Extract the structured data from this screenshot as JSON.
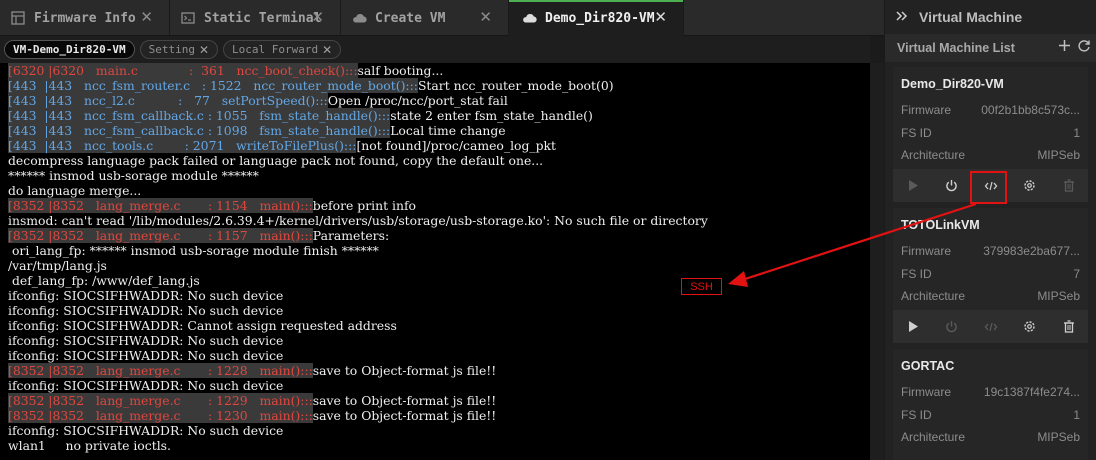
{
  "tabs": [
    {
      "label": "Firmware Info",
      "icon": "table-icon",
      "active": false
    },
    {
      "label": "Static Terminal",
      "icon": "terminal-icon",
      "active": false
    },
    {
      "label": "Create VM",
      "icon": "cloud-icon",
      "active": false
    },
    {
      "label": "Demo_Dir820-VM",
      "icon": "cloud-icon",
      "active": true
    }
  ],
  "close_symbol": "✕",
  "subtabs": [
    {
      "label": "VM-Demo_Dir820-VM",
      "active": true,
      "closable": false
    },
    {
      "label": "Setting",
      "active": false,
      "closable": true
    },
    {
      "label": "Local Forward",
      "active": false,
      "closable": true
    }
  ],
  "terminal_lines": [
    {
      "kind": "log",
      "color": "red",
      "tid": "[6320 |6320",
      "file": "main.c",
      "line": ":  361",
      "func": "ncc_boot_check()",
      "msg": "salf booting..."
    },
    {
      "kind": "log",
      "color": "blue",
      "tid": "[443  |443",
      "file": "ncc_fsm_router.c",
      "line": ": 1522",
      "func": "ncc_router_mode_boot()",
      "msg": "Start ncc_router_mode_boot(0)"
    },
    {
      "kind": "log",
      "color": "blue",
      "tid": "[443  |443",
      "file": "ncc_l2.c",
      "line": ":   77",
      "func": "setPortSpeed()",
      "msg": "Open /proc/ncc/port_stat fail"
    },
    {
      "kind": "log",
      "color": "blue",
      "tid": "[443  |443",
      "file": "ncc_fsm_callback.c",
      "line": ": 1055",
      "func": "fsm_state_handle()",
      "msg": "state 2 enter fsm_state_handle()"
    },
    {
      "kind": "log",
      "color": "blue",
      "tid": "[443  |443",
      "file": "ncc_fsm_callback.c",
      "line": ": 1098",
      "func": "fsm_state_handle()",
      "msg": "Local time change"
    },
    {
      "kind": "log",
      "color": "blue",
      "tid": "[443  |443",
      "file": "ncc_tools.c",
      "line": ": 2071",
      "func": "writeToFilePlus()",
      "msg": "[not found]/proc/cameo_log_pkt"
    },
    {
      "kind": "text",
      "text": "decompress language pack failed or language pack not found, copy the default one..."
    },
    {
      "kind": "text",
      "text": "****** insmod usb-sorage module ******"
    },
    {
      "kind": "text",
      "text": "do language merge..."
    },
    {
      "kind": "log",
      "color": "red",
      "tid": "[8352 |8352",
      "file": "lang_merge.c",
      "line": ": 1154",
      "func": "main()",
      "msg": "before print info"
    },
    {
      "kind": "text",
      "text": "insmod: can't read '/lib/modules/2.6.39.4+/kernel/drivers/usb/storage/usb-storage.ko': No such file or directory"
    },
    {
      "kind": "log",
      "color": "red",
      "tid": "[8352 |8352",
      "file": "lang_merge.c",
      "line": ": 1157",
      "func": "main()",
      "msg": "Parameters:"
    },
    {
      "kind": "text",
      "text": " ori_lang_fp: ****** insmod usb-sorage module finish ******"
    },
    {
      "kind": "text",
      "text": "/var/tmp/lang.js"
    },
    {
      "kind": "text",
      "text": " def_lang_fp: /www/def_lang.js"
    },
    {
      "kind": "text",
      "text": "ifconfig: SIOCSIFHWADDR: No such device"
    },
    {
      "kind": "text",
      "text": "ifconfig: SIOCSIFHWADDR: No such device"
    },
    {
      "kind": "text",
      "text": "ifconfig: SIOCSIFHWADDR: Cannot assign requested address"
    },
    {
      "kind": "text",
      "text": "ifconfig: SIOCSIFHWADDR: No such device"
    },
    {
      "kind": "text",
      "text": "ifconfig: SIOCSIFHWADDR: No such device"
    },
    {
      "kind": "log",
      "color": "red",
      "tid": "[8352 |8352",
      "file": "lang_merge.c",
      "line": ": 1228",
      "func": "main()",
      "msg": "save to Object-format js file!!"
    },
    {
      "kind": "text",
      "text": "ifconfig: SIOCSIFHWADDR: No such device"
    },
    {
      "kind": "log",
      "color": "red",
      "tid": "[8352 |8352",
      "file": "lang_merge.c",
      "line": ": 1229",
      "func": "main()",
      "msg": "save to Object-format js file!!"
    },
    {
      "kind": "log",
      "color": "red",
      "tid": "[8352 |8352",
      "file": "lang_merge.c",
      "line": ": 1230",
      "func": "main()",
      "msg": "save to Object-format js file!!"
    },
    {
      "kind": "text",
      "text": "ifconfig: SIOCSIFHWADDR: No such device"
    },
    {
      "kind": "text",
      "text": "wlan1     no private ioctls."
    }
  ],
  "panel": {
    "title": "Virtual Machine",
    "list_title": "Virtual Machine List",
    "add_icon": "plus-icon",
    "refresh_icon": "refresh-icon"
  },
  "field_labels": {
    "firmware": "Firmware",
    "fs_id": "FS ID",
    "architecture": "Architecture"
  },
  "vms": [
    {
      "name": "Demo_Dir820-VM",
      "firmware": "00f2b1bb8c573c...",
      "fs_id": "1",
      "architecture": "MIPSeb",
      "running": true
    },
    {
      "name": "TOTOLinkVM",
      "firmware": "379983e2ba677...",
      "fs_id": "7",
      "architecture": "MIPSeb",
      "running": false
    },
    {
      "name": "GORTAC",
      "firmware": "19c1387f4fe274...",
      "fs_id": "1",
      "architecture": "MIPSeb",
      "running": false
    }
  ],
  "annotation": {
    "label": "SSH",
    "color": "#e31212"
  },
  "colors": {
    "accent": "#4caf50",
    "log_blue": "#63a7e6",
    "log_red": "#e0473f"
  }
}
